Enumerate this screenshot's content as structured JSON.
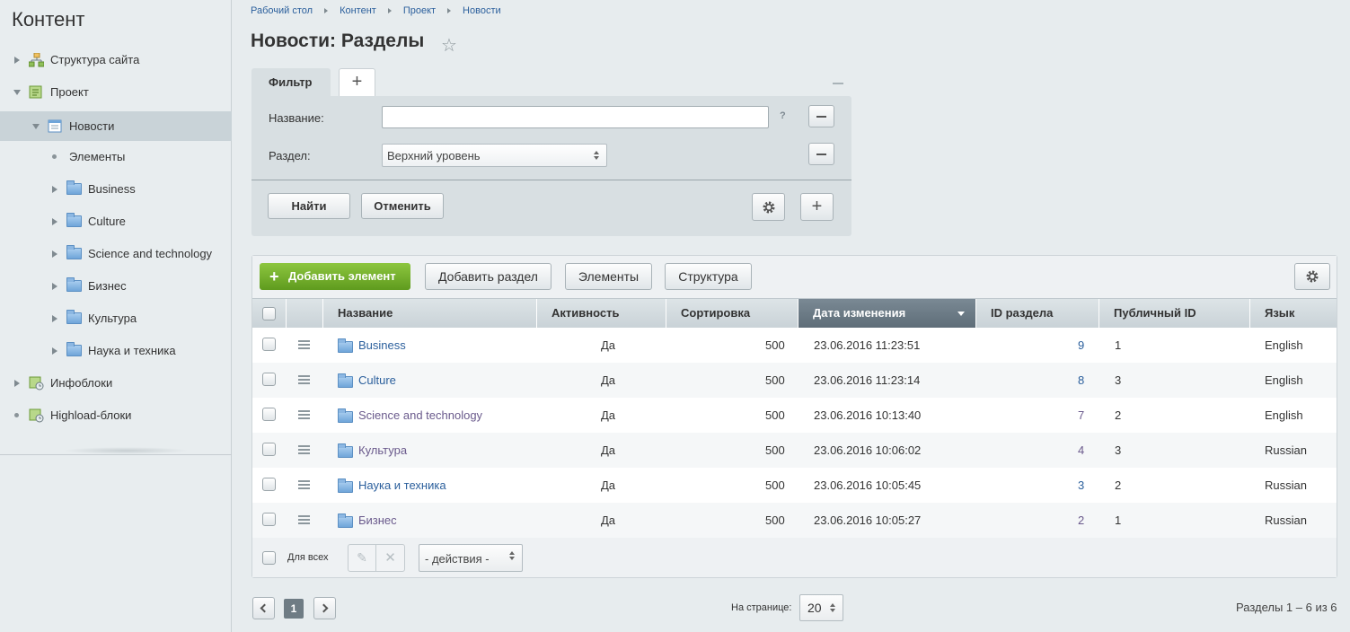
{
  "sidebar": {
    "title": "Контент",
    "items": [
      {
        "label": "Структура сайта",
        "expander": "right",
        "icon": "site-structure-icon"
      },
      {
        "label": "Проект",
        "expander": "down",
        "icon": "project-icon"
      },
      {
        "label": "Новости",
        "expander": "down",
        "icon": "news-icon",
        "active": true
      },
      {
        "label": "Элементы",
        "expander": "dot"
      },
      {
        "label": "Business",
        "expander": "right",
        "icon": "folder-icon"
      },
      {
        "label": "Culture",
        "expander": "right",
        "icon": "folder-icon"
      },
      {
        "label": "Science and technology",
        "expander": "right",
        "icon": "folder-icon"
      },
      {
        "label": "Бизнес",
        "expander": "right",
        "icon": "folder-icon"
      },
      {
        "label": "Культура",
        "expander": "right",
        "icon": "folder-icon"
      },
      {
        "label": "Наука и техника",
        "expander": "right",
        "icon": "folder-icon"
      },
      {
        "label": "Инфоблоки",
        "expander": "right",
        "icon": "infoblocks-icon"
      },
      {
        "label": "Highload-блоки",
        "expander": "dot",
        "icon": "highload-icon"
      }
    ]
  },
  "breadcrumb": [
    "Рабочий стол",
    "Контент",
    "Проект",
    "Новости"
  ],
  "page_title": "Новости: Разделы",
  "filter": {
    "tab_label": "Фильтр",
    "add_tab": "+",
    "name_label": "Название:",
    "name_value": "",
    "help": "?",
    "section_label": "Раздел:",
    "section_value": "Верхний уровень",
    "find_label": "Найти",
    "cancel_label": "Отменить"
  },
  "toolbar": {
    "add_element": "Добавить элемент",
    "add_section": "Добавить раздел",
    "elements": "Элементы",
    "structure": "Структура"
  },
  "table": {
    "columns": [
      "Название",
      "Активность",
      "Сортировка",
      "Дата изменения",
      "ID раздела",
      "Публичный ID",
      "Язык"
    ],
    "sorted_column": "Дата изменения",
    "rows": [
      {
        "name": "Business",
        "active": "Да",
        "sort": "500",
        "date": "23.06.2016 11:23:51",
        "id": "9",
        "public_id": "1",
        "lang": "English",
        "visited": false
      },
      {
        "name": "Culture",
        "active": "Да",
        "sort": "500",
        "date": "23.06.2016 11:23:14",
        "id": "8",
        "public_id": "3",
        "lang": "English",
        "visited": false
      },
      {
        "name": "Science and technology",
        "active": "Да",
        "sort": "500",
        "date": "23.06.2016 10:13:40",
        "id": "7",
        "public_id": "2",
        "lang": "English",
        "visited": true
      },
      {
        "name": "Культура",
        "active": "Да",
        "sort": "500",
        "date": "23.06.2016 10:06:02",
        "id": "4",
        "public_id": "3",
        "lang": "Russian",
        "visited": true
      },
      {
        "name": "Наука и техника",
        "active": "Да",
        "sort": "500",
        "date": "23.06.2016 10:05:45",
        "id": "3",
        "public_id": "2",
        "lang": "Russian",
        "visited": false
      },
      {
        "name": "Бизнес",
        "active": "Да",
        "sort": "500",
        "date": "23.06.2016 10:05:27",
        "id": "2",
        "public_id": "1",
        "lang": "Russian",
        "visited": true
      }
    ]
  },
  "footer": {
    "for_all": "Для всех",
    "actions": "- действия -"
  },
  "pagination": {
    "current_page": "1",
    "per_page_label": "На странице:",
    "per_page_value": "20",
    "count_text": "Разделы 1 – 6 из 6"
  },
  "colors": {
    "accent_green": "#6fae2a",
    "link": "#2b5f9c",
    "sorted_header": "#6b7a85"
  }
}
